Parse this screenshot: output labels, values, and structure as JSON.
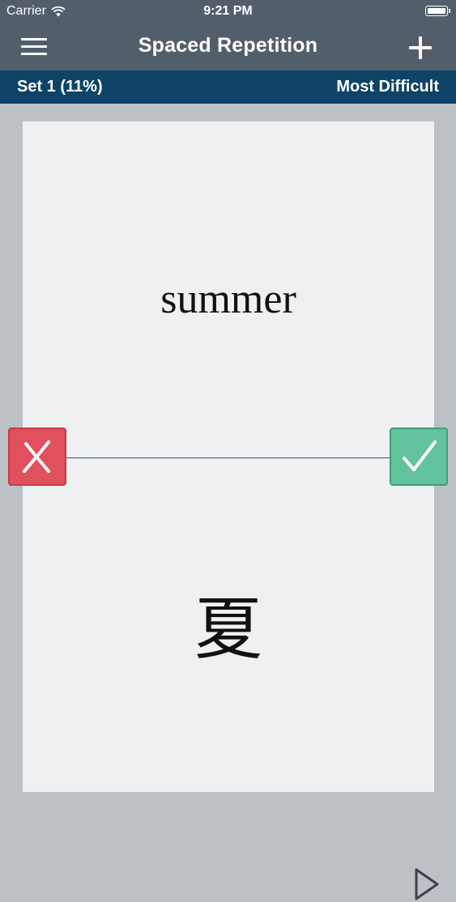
{
  "status_bar": {
    "carrier": "Carrier",
    "time": "9:21 PM"
  },
  "nav": {
    "title": "Spaced Repetition",
    "menu_icon": "hamburger-menu-icon",
    "add_icon": "plus-icon"
  },
  "set_bar": {
    "set_label": "Set 1 (11%)",
    "filter_label": "Most Difficult"
  },
  "card": {
    "front": "summer",
    "back": "夏"
  },
  "controls": {
    "wrong_icon": "x-icon",
    "correct_icon": "checkmark-icon",
    "play_icon": "play-icon"
  },
  "colors": {
    "nav_background": "#535e6b",
    "set_bar_background": "#0d4367",
    "wrong": "#e0505d",
    "correct": "#62c39c",
    "card_background": "#eef0f2"
  }
}
